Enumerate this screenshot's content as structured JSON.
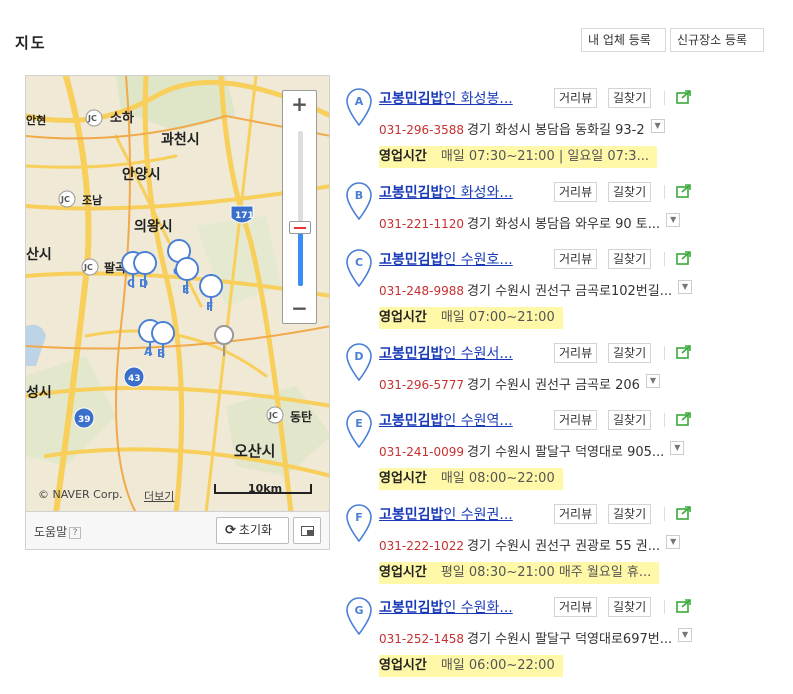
{
  "header": {
    "title": "지도",
    "register_label": "내 업체 등록",
    "new_place_label": "신규장소 등록"
  },
  "map": {
    "copyright": "© NAVER Corp.",
    "more_label": "더보기",
    "scale_label": "10km",
    "zoom_in": "+",
    "zoom_out": "−",
    "zoom_level": 0.62,
    "help_label": "도움말",
    "help_q": "?",
    "reset_icon": "⟳",
    "reset_label": "초기화",
    "place_labels": [
      "소하",
      "과천시",
      "안양시",
      "조남",
      "의왕시",
      "팔곡",
      "산시",
      "동탄",
      "오산시",
      "성시",
      "안현"
    ],
    "road_shields": [
      "171",
      "43",
      "39"
    ],
    "markers": [
      "G",
      "C",
      "D",
      "E",
      "F",
      "A",
      "B"
    ],
    "colors": {
      "water": "#bcd4e6",
      "road": "#f7cf5a",
      "land": "#efe9d5",
      "marker": "#4a7fd6"
    }
  },
  "results": [
    {
      "letter": "A",
      "name_bold": "고봉민김밥",
      "name_rest": "인 화성봉...",
      "review": "거리뷰",
      "route": "길찾기",
      "tel": "031-296-3588",
      "address": "경기 화성시 봉담읍 동화길 93-2",
      "hours_label": "영업시간",
      "hours": "매일 07:30~21:00 | 일요일 07:3..."
    },
    {
      "letter": "B",
      "name_bold": "고봉민김밥",
      "name_rest": "인 화성와...",
      "review": "거리뷰",
      "route": "길찾기",
      "tel": "031-221-1120",
      "address": "경기 화성시 봉담읍 와우로 90 토...",
      "hours_label": "",
      "hours": ""
    },
    {
      "letter": "C",
      "name_bold": "고봉민김밥",
      "name_rest": "인 수원호...",
      "review": "거리뷰",
      "route": "길찾기",
      "tel": "031-248-9988",
      "address": "경기 수원시 권선구 금곡로102번길...",
      "hours_label": "영업시간",
      "hours": "매일 07:00~21:00"
    },
    {
      "letter": "D",
      "name_bold": "고봉민김밥",
      "name_rest": "인 수원서...",
      "review": "거리뷰",
      "route": "길찾기",
      "tel": "031-296-5777",
      "address": "경기 수원시 권선구 금곡로 206",
      "hours_label": "",
      "hours": ""
    },
    {
      "letter": "E",
      "name_bold": "고봉민김밥",
      "name_rest": "인 수원역...",
      "review": "거리뷰",
      "route": "길찾기",
      "tel": "031-241-0099",
      "address": "경기 수원시 팔달구 덕영대로 905...",
      "hours_label": "영업시간",
      "hours": "매일 08:00~22:00"
    },
    {
      "letter": "F",
      "name_bold": "고봉민김밥",
      "name_rest": "인 수원권...",
      "review": "거리뷰",
      "route": "길찾기",
      "tel": "031-222-1022",
      "address": "경기 수원시 권선구 권광로 55 권...",
      "hours_label": "영업시간",
      "hours": "평일 08:30~21:00 매주 월요일 휴..."
    },
    {
      "letter": "G",
      "name_bold": "고봉민김밥",
      "name_rest": "인 수원화...",
      "review": "거리뷰",
      "route": "길찾기",
      "tel": "031-252-1458",
      "address": "경기 수원시 팔달구 덕영대로697번...",
      "hours_label": "영업시간",
      "hours": "매일 06:00~22:00"
    }
  ]
}
